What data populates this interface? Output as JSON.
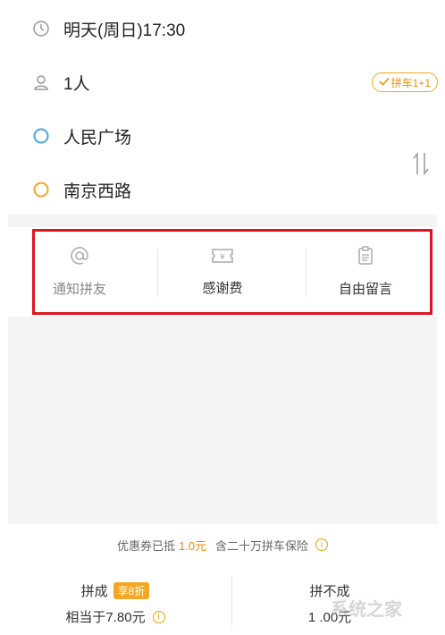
{
  "trip": {
    "time": "明天(周日)17:30",
    "passengers": "1人",
    "carpool_tag": "拼车1+1",
    "origin": "人民广场",
    "destination": "南京西路"
  },
  "actions": {
    "notify": "通知拼友",
    "thanks_fee": "感谢费",
    "message": "自由留言"
  },
  "coupon": {
    "prefix": "优惠券已抵",
    "amount": "1.0元",
    "insurance": "含二十万拼车保险"
  },
  "price": {
    "left_title": "拼成",
    "discount_badge": "享8折",
    "left_price": "相当于7.80元",
    "right_title": "拼不成",
    "right_price": "1 .00元"
  },
  "watermark": "系统之家",
  "colors": {
    "accent": "#f5a623",
    "origin_dot": "#4aa3e8",
    "destination_dot": "#f5a623",
    "highlight_box": "#e0141e"
  }
}
